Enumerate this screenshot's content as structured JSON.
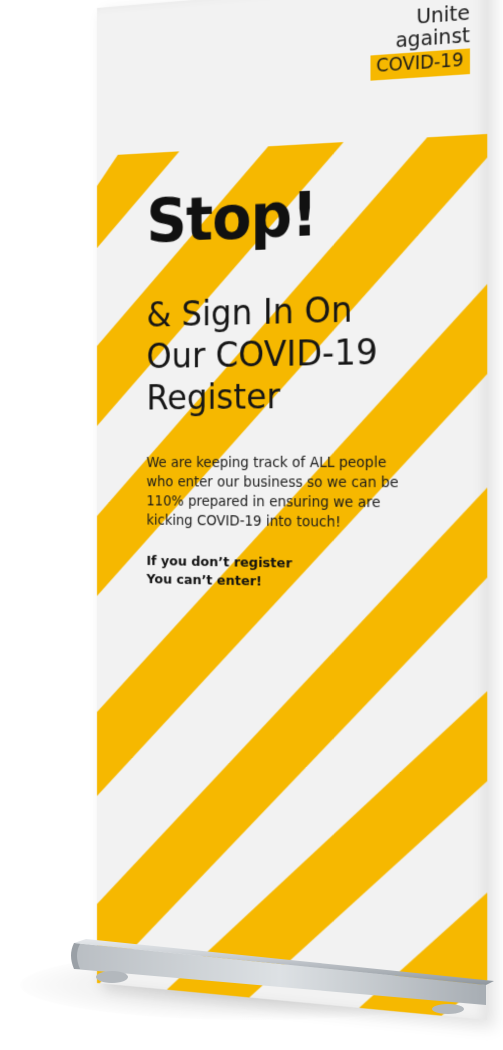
{
  "logo": {
    "line1": "Unite",
    "line2": "against",
    "tag": "COVID-19"
  },
  "headline": "Stop!",
  "subhead": {
    "line1": "& Sign In On",
    "line2": "Our COVID-19",
    "line3": "Register"
  },
  "body": {
    "line1": "We are keeping track of ALL people",
    "line2": "who enter our business so we can be",
    "line3": "110% prepared in ensuring we are",
    "line4": "kicking COVID-19 into touch!"
  },
  "warning": {
    "line1": "If you don’t register",
    "line2": "You can’t enter!"
  },
  "colors": {
    "accent_yellow": "#f6b800",
    "banner_background": "#f2f2f2",
    "text": "#111111",
    "base_metal": "#c8ccd0"
  }
}
